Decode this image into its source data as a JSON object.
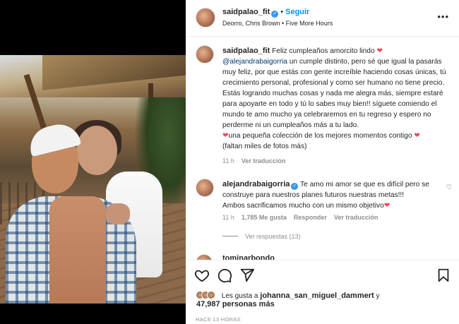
{
  "post": {
    "username": "saidpalao_fit",
    "follow_label": "Seguir",
    "audio": "Deorro, Chris Brown • Five More Hours",
    "more_label": "•••"
  },
  "caption": {
    "username": "saidpalao_fit",
    "text_1": "Feliz cumpleaños amorcito lindo",
    "mention": "@alejandrabaigorria",
    "text_2": " un cumple distinto, pero sé que igual la pasarás muy feliz, por que estás con gente increíble haciendo cosas únicas, tú crecimiento personal, profesional y como ser humano no tiene precio. Estás logrando muchas cosas y nada me alegra más, siempre estaré para apoyarte en todo y tú lo sabes muy bien!! síguete comiendo el mundo te amo mucho ya celebraremos en tu regreso y espero no perderme ni un cumpleaños más a tu lado.",
    "text_3": "una pequeña colección de los mejores momentos contigo",
    "text_4": "(faltan miles de fotos más)",
    "time": "11 h",
    "translate": "Ver traducción"
  },
  "comment": {
    "username": "alejandrabaigorria",
    "text_1": "Te amo mi amor se que es difícil pero se construye para nuestros planes futuros nuestras metas!!!",
    "text_2": "Ambos sacrificamos mucho con un mismo objetivo",
    "time": "11 h",
    "likes": "1,785 Me gusta",
    "reply": "Responder",
    "translate": "Ver traducción",
    "view_replies": "Ver respuestas (13)"
  },
  "partial_comment": {
    "username": "tominarbondo"
  },
  "likes": {
    "prefix": "Les gusta a",
    "user": "johanna_san_miguel_dammert",
    "and": "y",
    "count": "47,987 personas más"
  },
  "timestamp": "HACE 13 HORAS",
  "colors": {
    "accent": "#0095f6",
    "heart": "#ed4956",
    "verified": "#3897f0",
    "muted": "#8e8e8e"
  }
}
